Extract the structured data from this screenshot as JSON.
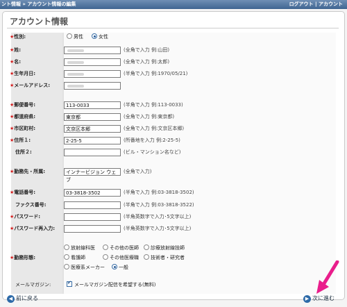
{
  "topbar": {
    "breadcrumb": "ント情報 » アカウント情報の編集",
    "links": "ログアウト | アカウント"
  },
  "page": {
    "title": "アカウント情報"
  },
  "fields": {
    "gender": {
      "label": "性別:",
      "options": [
        "男性",
        "女性"
      ]
    },
    "sei": {
      "label": "姓:",
      "value": "",
      "hint": "(全角で入力 例:山田)"
    },
    "mei": {
      "label": "名:",
      "value": "",
      "hint": "(全角で入力 例:太郎)"
    },
    "birthday": {
      "label": "生年月日:",
      "value": "",
      "hint": "(半角で入力 例:1970/05/21)"
    },
    "email": {
      "label": "メールアドレス:",
      "value": ""
    },
    "postal": {
      "label": "郵便番号:",
      "value": "113-0033",
      "hint": "(半角で入力 例:113-0033)"
    },
    "prefecture": {
      "label": "都道府県:",
      "value": "東京都",
      "hint": "(全角で入力 例:東京都)"
    },
    "city": {
      "label": "市区町村:",
      "value": "文京区本郷",
      "hint": "(全角で入力 例:文京区本郷)"
    },
    "address1": {
      "label": "住所１:",
      "value": "2-25-5",
      "hint": "(所番地を入力 例:2-25-5)"
    },
    "address2": {
      "label": "住所２:",
      "value": "",
      "hint": "(ビル・マンション名など)"
    },
    "company": {
      "label": "勤務先・所属:",
      "value": "インナービジョン ウェブ",
      "hint": "(全角で入力)"
    },
    "phone": {
      "label": "電話番号:",
      "value": "03-3818-3502",
      "hint": "(半角で入力 例:03-3818-3502)"
    },
    "fax": {
      "label": "ファクス番号:",
      "value": "",
      "hint": "(半角で入力 例:03-3818-3522)"
    },
    "password": {
      "label": "パスワード:",
      "value": "",
      "hint": "(半角英数字で入力･5文字以上)"
    },
    "password_confirm": {
      "label": "パスワード再入力:",
      "value": "",
      "hint": "(半角英数字で入力･5文字以上)"
    },
    "work": {
      "label": "勤務形態:",
      "options": [
        "放射線科医",
        "その他の医師",
        "診療放射線技師",
        "看護師",
        "その他医療職",
        "技術者・研究者",
        "医療系メーカー",
        "一般"
      ]
    },
    "mailmag": {
      "label": "メールマガジン:",
      "option": "メールマガジン配信を希望する(無料)"
    }
  },
  "buttons": {
    "back": "前に戻る",
    "next": "次に進む"
  },
  "colors": {
    "accent": "#2d6aa8",
    "required": "#d31b1b",
    "arrow": "#e91e8c"
  }
}
